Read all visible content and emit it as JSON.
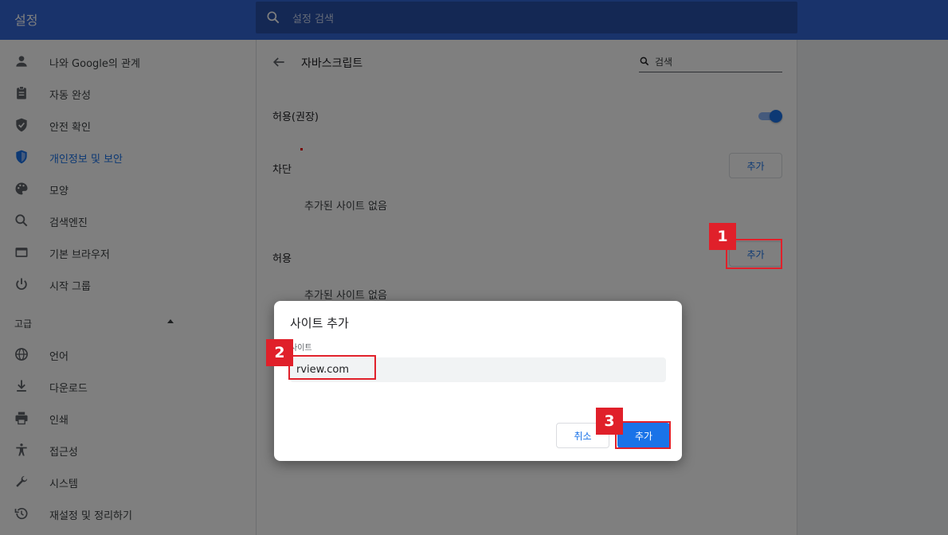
{
  "header": {
    "title": "설정",
    "search_placeholder": "설정 검색"
  },
  "sidebar": {
    "items": [
      {
        "label": "나와 Google의 관계",
        "icon": "person-icon"
      },
      {
        "label": "자동 완성",
        "icon": "clipboard-icon"
      },
      {
        "label": "안전 확인",
        "icon": "shield-check-icon"
      },
      {
        "label": "개인정보 및 보안",
        "icon": "shield-lock-icon",
        "active": true
      },
      {
        "label": "모양",
        "icon": "palette-icon"
      },
      {
        "label": "검색엔진",
        "icon": "search-icon"
      },
      {
        "label": "기본 브라우저",
        "icon": "browser-window-icon"
      },
      {
        "label": "시작 그룹",
        "icon": "power-icon"
      }
    ],
    "advanced_label": "고급",
    "advanced_items": [
      {
        "label": "언어",
        "icon": "globe-icon"
      },
      {
        "label": "다운로드",
        "icon": "download-icon"
      },
      {
        "label": "인쇄",
        "icon": "printer-icon"
      },
      {
        "label": "접근성",
        "icon": "accessibility-icon"
      },
      {
        "label": "시스템",
        "icon": "wrench-icon"
      },
      {
        "label": "재설정 및 정리하기",
        "icon": "history-icon"
      }
    ]
  },
  "main": {
    "title": "자바스크립트",
    "search_placeholder": "검색",
    "allowed_recommended_label": "허용(권장)",
    "toggle_on": true,
    "block_section": {
      "label": "차단",
      "add_label": "추가",
      "empty_text": "추가된 사이트 없음"
    },
    "allow_section": {
      "label": "허용",
      "add_label": "추가",
      "empty_text": "추가된 사이트 없음"
    }
  },
  "dialog": {
    "title": "사이트 추가",
    "field_label": "사이트",
    "input_value": "rview.com",
    "cancel_label": "취소",
    "confirm_label": "추가"
  },
  "annotations": [
    {
      "number": "1"
    },
    {
      "number": "2"
    },
    {
      "number": "3"
    }
  ],
  "colors": {
    "header": "#3367d6",
    "accent": "#1a73e8",
    "annotation_red": "#e0202a"
  }
}
